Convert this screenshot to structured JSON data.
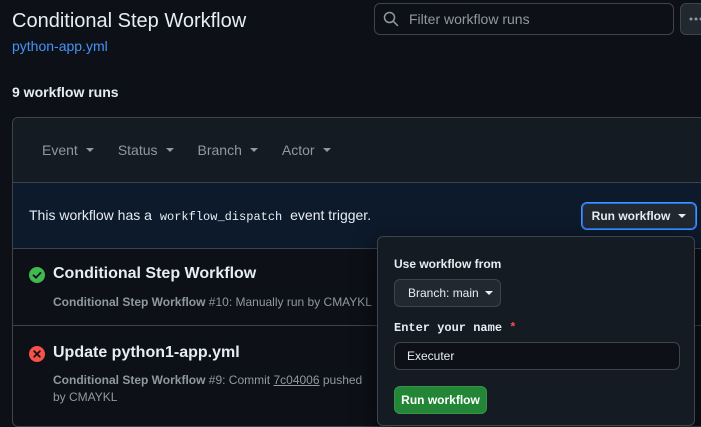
{
  "header": {
    "title": "Conditional Step Workflow",
    "file_link": "python-app.yml"
  },
  "search": {
    "placeholder": "Filter workflow runs"
  },
  "runs_count": "9 workflow runs",
  "filters": [
    "Event",
    "Status",
    "Branch",
    "Actor"
  ],
  "dispatch": {
    "text_before": "This workflow has a ",
    "code": "workflow_dispatch",
    "text_after": " event trigger.",
    "button_label": "Run workflow"
  },
  "runs": [
    {
      "title": "Conditional Step Workflow",
      "status": "success",
      "workflow": "Conditional Step Workflow",
      "number": "#10",
      "detail": ": Manually run by CMAYKL"
    },
    {
      "title": "Update python1-app.yml",
      "status": "failure",
      "workflow": "Conditional Step Workflow",
      "number": "#9",
      "detail_prefix": ": Commit ",
      "commit": "7c04006",
      "detail_suffix": " pushed by CMAYKL"
    }
  ],
  "popover": {
    "use_from_label": "Use workflow from",
    "branch_button": "Branch: main",
    "input_label": "Enter your name",
    "required_mark": "*",
    "input_value": "Executer",
    "submit_label": "Run workflow"
  },
  "colors": {
    "background": "#0d1117",
    "link": "#4493f8",
    "success": "#3fb950",
    "failure": "#f85149",
    "primary_button": "#238636"
  }
}
